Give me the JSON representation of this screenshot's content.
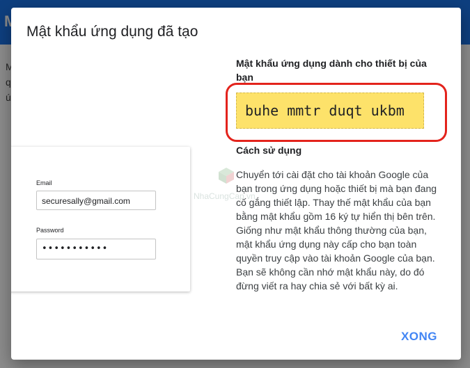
{
  "background": {
    "header_letter": "M",
    "fragments": [
      "M",
      "q",
      "ú"
    ]
  },
  "dialog": {
    "title": "Mật khẩu ứng dụng đã tạo",
    "illustration": {
      "email_label": "Email",
      "email_value": "securesally@gmail.com",
      "password_label": "Password",
      "password_value": "•••••••••••"
    },
    "password_heading": "Mật khẩu ứng dụng dành cho thiết bị của bạn",
    "app_password": "buhe mmtr duqt ukbm",
    "usage_heading": "Cách sử dụng",
    "usage_paragraph_1": "Chuyển tới cài đặt cho tài khoản Google của bạn trong ứng dụng hoặc thiết bị mà bạn đang cố gắng thiết lập. Thay thế mật khẩu của bạn bằng mật khẩu gồm 16 ký tự hiển thị bên trên.",
    "usage_paragraph_2": "Giống như mật khẩu thông thường của bạn, mật khẩu ứng dụng này cấp cho bạn toàn quyền truy cập vào tài khoản Google của bạn. Bạn sẽ không cần nhớ mật khẩu này, do đó đừng viết ra hay chia sẻ với bất kỳ ai.",
    "done_label": "XONG"
  },
  "watermark": {
    "text": "NhaCungCap.vn"
  },
  "colors": {
    "accent": "#4285f4",
    "password_background": "#fde26a",
    "highlight_ring": "#e3231c",
    "header": "#1a73e8"
  },
  "icons": {
    "watermark_logo": "cube-logo-icon"
  }
}
